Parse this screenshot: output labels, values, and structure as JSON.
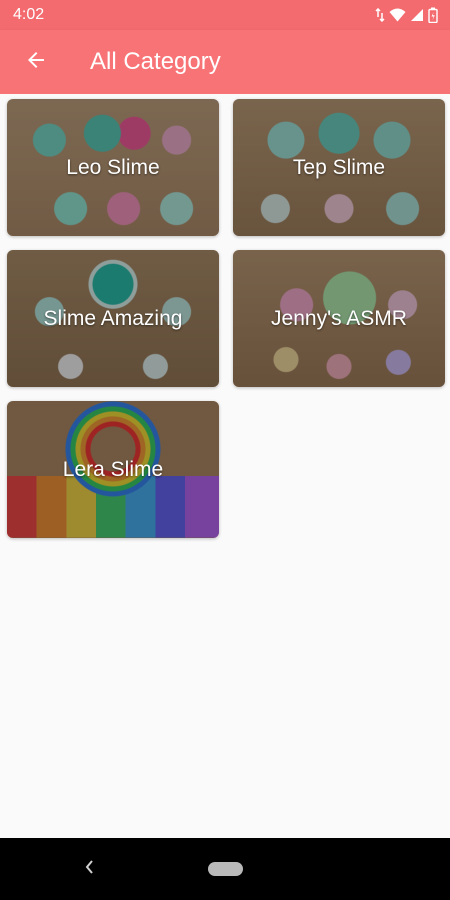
{
  "status_bar": {
    "time": "4:02",
    "icons": [
      "data-transfer-icon",
      "wifi-icon",
      "cellular-signal-icon",
      "battery-icon"
    ]
  },
  "app_bar": {
    "title": "All Category",
    "back_icon": "arrow-left-icon",
    "background_color": "#f87376"
  },
  "categories": [
    {
      "label": "Leo Slime"
    },
    {
      "label": "Tep Slime"
    },
    {
      "label": "Slime Amazing"
    },
    {
      "label": "Jenny's ASMR"
    },
    {
      "label": "Lera Slime"
    }
  ],
  "nav_bar": {
    "back_icon": "chevron-left-icon",
    "home_icon": "home-pill-icon"
  }
}
